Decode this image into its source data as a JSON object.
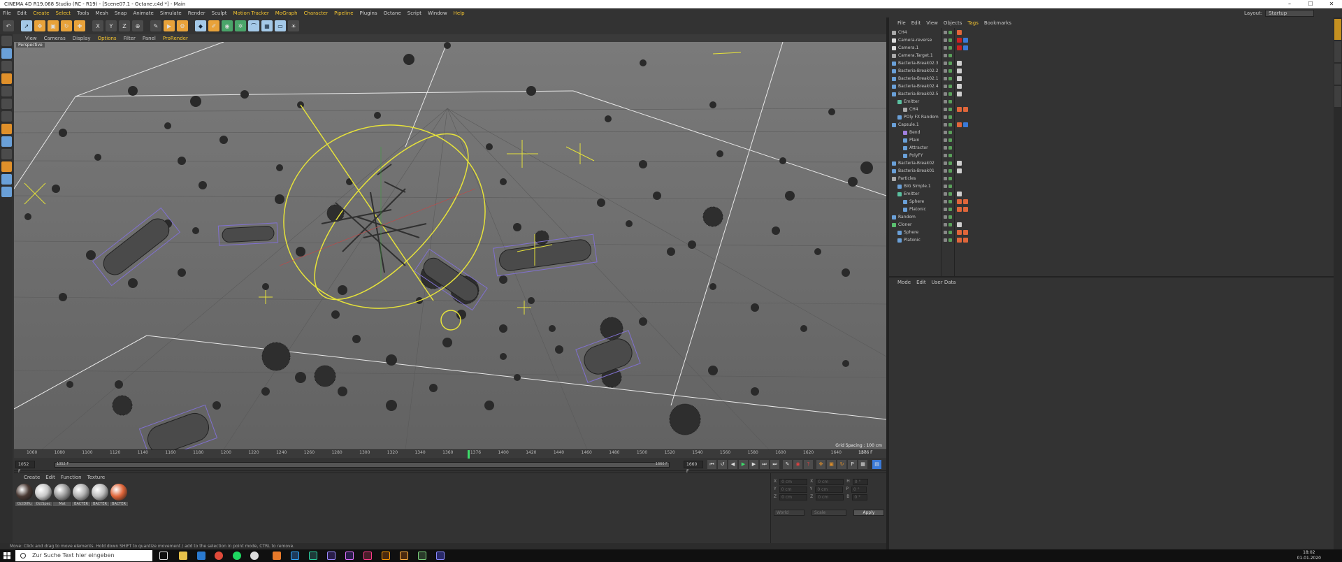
{
  "window": {
    "title": "CINEMA 4D R19.068 Studio (RC - R19) - [Scene07.1 - Octane.c4d *] - Main",
    "controls": [
      "–",
      "☐",
      "✕"
    ]
  },
  "menubar": {
    "items": [
      "File",
      "Edit",
      "Create",
      "Select",
      "Tools",
      "Mesh",
      "Snap",
      "Animate",
      "Simulate",
      "Render",
      "Sculpt",
      "Motion Tracker",
      "MoGraph",
      "Character",
      "Pipeline",
      "Plugins",
      "Octane",
      "Script",
      "Window",
      "Help"
    ],
    "layout_label": "Layout:",
    "layout_value": "Startup"
  },
  "viewport": {
    "menu": [
      "View",
      "Cameras",
      "Display",
      "Options",
      "Filter",
      "Panel",
      "ProRender"
    ],
    "label": "Perspective",
    "grid_spacing": "Grid Spacing : 100 cm"
  },
  "timeline": {
    "ticks": [
      "1060",
      "1080",
      "1100",
      "1120",
      "1140",
      "1160",
      "1180",
      "1200",
      "1220",
      "1240",
      "1260",
      "1280",
      "1300",
      "1320",
      "1340",
      "1360",
      "1376",
      "1400",
      "1420",
      "1440",
      "1460",
      "1480",
      "1500",
      "1520",
      "1540",
      "1560",
      "1580",
      "1600",
      "1620",
      "1640",
      "166"
    ],
    "current": "1376",
    "frame_display": "1376 F"
  },
  "transport": {
    "start": "1052 F",
    "range_start": "1052 F",
    "range_end": "1660 F",
    "end": "1660 F"
  },
  "material_manager": {
    "menu": [
      "Create",
      "Edit",
      "Function",
      "Texture"
    ],
    "materials": [
      {
        "label": "OctDiffu",
        "color": "#4a3a34"
      },
      {
        "label": "OctSpec",
        "color": "#c8c8c8"
      },
      {
        "label": "Mat",
        "color": "#9a9a9a"
      },
      {
        "label": "BACTER",
        "color": "#b0b0b0"
      },
      {
        "label": "BACTER",
        "color": "#bcbcbc"
      },
      {
        "label": "BACTER",
        "color": "#e0663a"
      }
    ]
  },
  "coordinates": {
    "rows": [
      {
        "a": "X",
        "v1": "0 cm",
        "b": "X",
        "v2": "0 cm",
        "c": "H",
        "v3": "0 °"
      },
      {
        "a": "Y",
        "v1": "0 cm",
        "b": "Y",
        "v2": "0 cm",
        "c": "P",
        "v3": "0 °"
      },
      {
        "a": "Z",
        "v1": "0 cm",
        "b": "Z",
        "v2": "0 cm",
        "c": "B",
        "v3": "0 °"
      }
    ],
    "mode": "World",
    "size_mode": "Scale",
    "apply": "Apply"
  },
  "status": {
    "text": "Move: Click and drag to move elements. Hold down SHIFT to quantize movement / add to the selection in point mode, CTRL to remove."
  },
  "object_manager": {
    "menu": [
      "File",
      "Edit",
      "View",
      "Objects",
      "Tags",
      "Bookmarks"
    ],
    "objects": [
      {
        "name": "CH4",
        "indent": 0,
        "icon": "null-icon",
        "tags": [
          "#e0663a"
        ]
      },
      {
        "name": "Camera-reverse",
        "indent": 0,
        "icon": "camera-icon",
        "tags": [
          "#cc2222",
          "#3a7ad8"
        ]
      },
      {
        "name": "Camera.1",
        "indent": 0,
        "icon": "camera-icon",
        "tags": [
          "#cc2222",
          "#3a7ad8"
        ]
      },
      {
        "name": "Camera.Target.1",
        "indent": 0,
        "icon": "null-icon",
        "tags": []
      },
      {
        "name": "Bacteria-Break02.3",
        "indent": 0,
        "icon": "object-icon",
        "tags": [
          "#cfcfcf"
        ]
      },
      {
        "name": "Bacteria-Break02.2",
        "indent": 0,
        "icon": "object-icon",
        "tags": [
          "#cfcfcf"
        ]
      },
      {
        "name": "Bacteria-Break02.1",
        "indent": 0,
        "icon": "object-icon",
        "tags": [
          "#cfcfcf"
        ]
      },
      {
        "name": "Bacteria-Break02.4",
        "indent": 0,
        "icon": "object-icon",
        "tags": [
          "#cfcfcf"
        ]
      },
      {
        "name": "Bacteria-Break02.5",
        "indent": 0,
        "icon": "object-icon",
        "tags": [
          "#cfcfcf"
        ]
      },
      {
        "name": "Emitter",
        "indent": 1,
        "icon": "emitter-icon",
        "tags": []
      },
      {
        "name": "CH4",
        "indent": 2,
        "icon": "null-icon",
        "tags": [
          "#e0663a",
          "#e0663a"
        ]
      },
      {
        "name": "POly FX Random",
        "indent": 1,
        "icon": "effector-icon",
        "tags": []
      },
      {
        "name": "Capsule.1",
        "indent": 0,
        "icon": "capsule-icon",
        "tags": [
          "#e0663a",
          "#3a7ad8"
        ]
      },
      {
        "name": "Bend",
        "indent": 2,
        "icon": "deformer-icon",
        "tags": []
      },
      {
        "name": "Plain",
        "indent": 2,
        "icon": "effector-icon",
        "tags": []
      },
      {
        "name": "Attractor",
        "indent": 2,
        "icon": "effector-icon",
        "tags": []
      },
      {
        "name": "PolyFY",
        "indent": 2,
        "icon": "effector-icon",
        "tags": []
      },
      {
        "name": "Bacteria-Break02",
        "indent": 0,
        "icon": "object-icon",
        "tags": [
          "#cfcfcf"
        ]
      },
      {
        "name": "Bacteria-Break01",
        "indent": 0,
        "icon": "object-icon",
        "tags": [
          "#cfcfcf"
        ]
      },
      {
        "name": "Particles",
        "indent": 0,
        "icon": "null-icon",
        "tags": []
      },
      {
        "name": "BIG Simple.1",
        "indent": 1,
        "icon": "effector-icon",
        "tags": []
      },
      {
        "name": "Emitter",
        "indent": 1,
        "icon": "emitter-icon",
        "tags": [
          "#cfcfcf"
        ]
      },
      {
        "name": "Sphere",
        "indent": 2,
        "icon": "sphere-icon",
        "tags": [
          "#e0663a",
          "#e0663a"
        ]
      },
      {
        "name": "Platonic",
        "indent": 2,
        "icon": "sphere-icon",
        "tags": [
          "#e0663a",
          "#e0663a"
        ]
      },
      {
        "name": "Random",
        "indent": 0,
        "icon": "effector-icon",
        "tags": []
      },
      {
        "name": "Cloner",
        "indent": 0,
        "icon": "cloner-icon",
        "tags": [
          "#cfcfcf"
        ]
      },
      {
        "name": "Sphere",
        "indent": 1,
        "icon": "sphere-icon",
        "tags": [
          "#e0663a",
          "#e0663a"
        ]
      },
      {
        "name": "Platonic",
        "indent": 1,
        "icon": "sphere-icon",
        "tags": [
          "#e0663a",
          "#e0663a"
        ]
      }
    ]
  },
  "attribute_manager": {
    "menu": [
      "Mode",
      "Edit",
      "User Data"
    ]
  },
  "taskbar": {
    "search_placeholder": "Zur Suche Text hier eingeben",
    "time": "18:02",
    "date": "01.01.2020"
  }
}
